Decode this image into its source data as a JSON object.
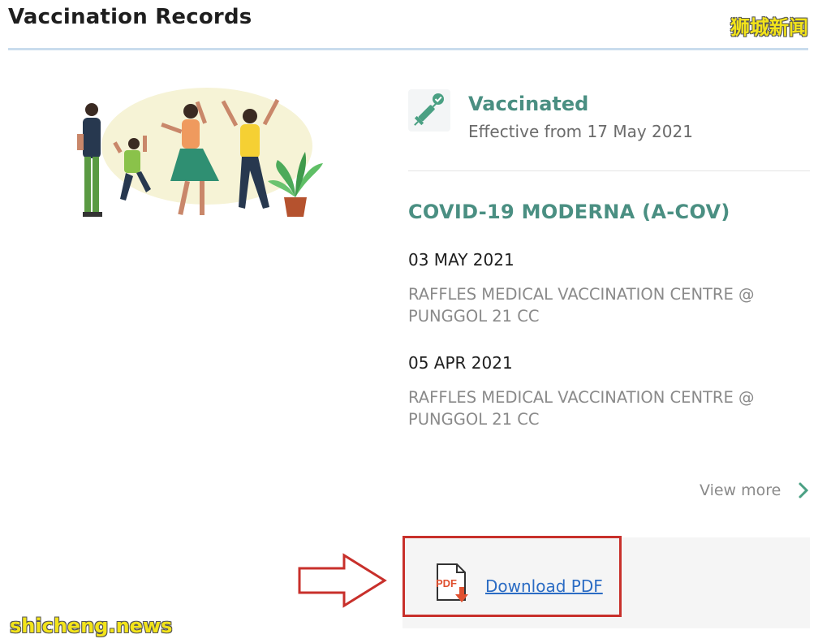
{
  "header": {
    "title": "Vaccination Records"
  },
  "watermarks": {
    "top": "狮城新闻",
    "bottom": "shicheng.news"
  },
  "status": {
    "icon": "syringe-check-icon",
    "label": "Vaccinated",
    "effective": "Effective from 17 May 2021"
  },
  "vaccine": {
    "name": "COVID-19 MODERNA (A-COV)",
    "doses": [
      {
        "date": "03 MAY 2021",
        "place": "RAFFLES MEDICAL VACCINATION CENTRE @ PUNGGOL 21 CC"
      },
      {
        "date": "05 APR 2021",
        "place": "RAFFLES MEDICAL VACCINATION CENTRE @ PUNGGOL 21 CC"
      }
    ]
  },
  "actions": {
    "view_more": "View more",
    "download_pdf": "Download PDF",
    "pdf_icon_text": "PDF"
  },
  "colors": {
    "accent": "#4a8f82",
    "link": "#2b6cc4",
    "highlight": "#c8302b",
    "watermark": "#f3e41a"
  }
}
